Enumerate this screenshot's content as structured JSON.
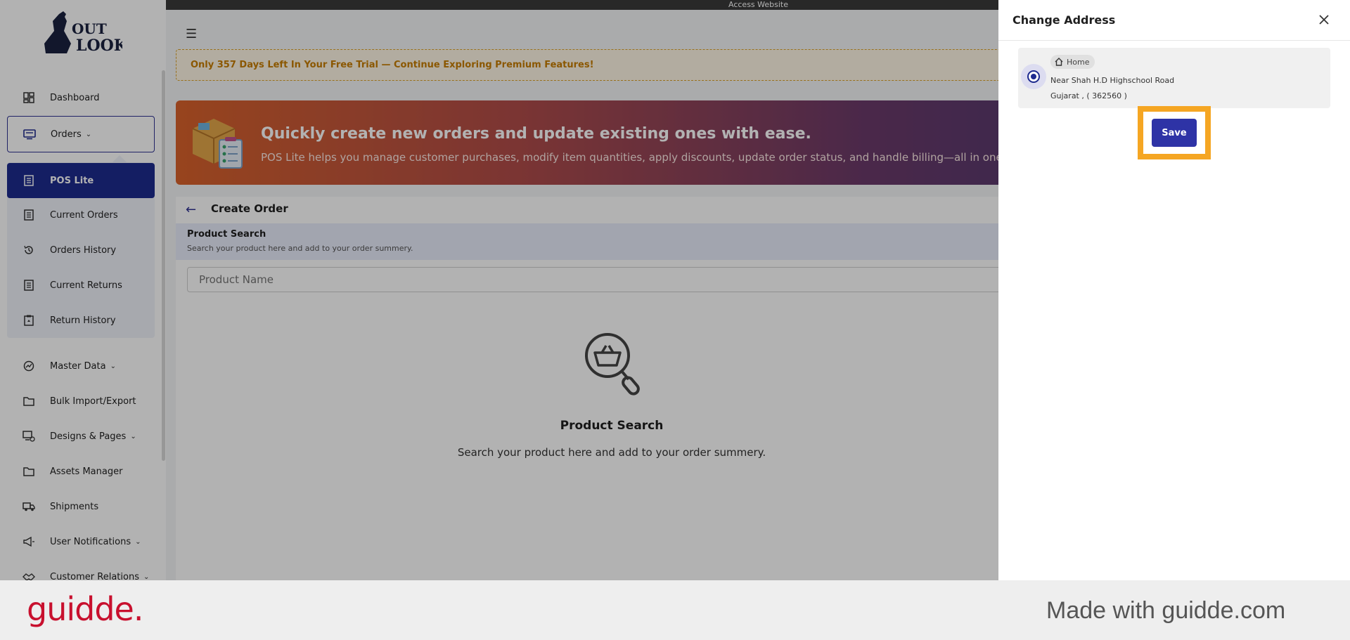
{
  "app": {
    "logo_alt": "Out Look"
  },
  "sidebar": {
    "items": [
      {
        "label": "Dashboard",
        "icon": "dashboard-icon"
      },
      {
        "label": "Orders",
        "icon": "monitor-icon",
        "expanded": true
      },
      {
        "label": "POS Lite",
        "icon": "receipt-icon",
        "active": true
      },
      {
        "label": "Current Orders",
        "icon": "list-icon"
      },
      {
        "label": "Orders History",
        "icon": "history-icon"
      },
      {
        "label": "Current Returns",
        "icon": "list-icon"
      },
      {
        "label": "Return History",
        "icon": "clipboard-icon"
      },
      {
        "label": "Master Data",
        "icon": "chart-icon"
      },
      {
        "label": "Bulk Import/Export",
        "icon": "folder-icon"
      },
      {
        "label": "Designs & Pages",
        "icon": "design-icon"
      },
      {
        "label": "Assets Manager",
        "icon": "folder-icon"
      },
      {
        "label": "Shipments",
        "icon": "truck-icon"
      },
      {
        "label": "User Notifications",
        "icon": "megaphone-icon"
      },
      {
        "label": "Customer Relations",
        "icon": "handshake-icon"
      }
    ]
  },
  "topbar": {
    "access_website": "Access Website"
  },
  "trial_banner": {
    "text": "Only 357 Days Left In Your Free Trial — Continue Exploring Premium Features!"
  },
  "hero": {
    "title": "Quickly create new orders and update existing ones with ease.",
    "subtitle": "POS Lite helps you manage customer purchases, modify item quantities, apply discounts, update order status, and handle billing—all in one stream"
  },
  "create_order": {
    "title": "Create Order",
    "product_search_title": "Product Search",
    "product_search_sub": "Search your product here and add to your order summery.",
    "input_placeholder": "Product Name",
    "empty_title": "Product Search",
    "empty_sub": "Search your product here and add to your order summery."
  },
  "drawer": {
    "title": "Change Address",
    "address": {
      "tag": "Home",
      "line1": "Near Shah H.D Highschool Road",
      "line2": "Gujarat , ( 362560 )",
      "selected": true
    },
    "save_label": "Save"
  },
  "footer": {
    "brand": "guidde.",
    "made_with": "Made with guidde.com"
  },
  "colors": {
    "primary": "#1e2b8f",
    "highlight": "#f5a623",
    "brand_red": "#c8102e"
  }
}
